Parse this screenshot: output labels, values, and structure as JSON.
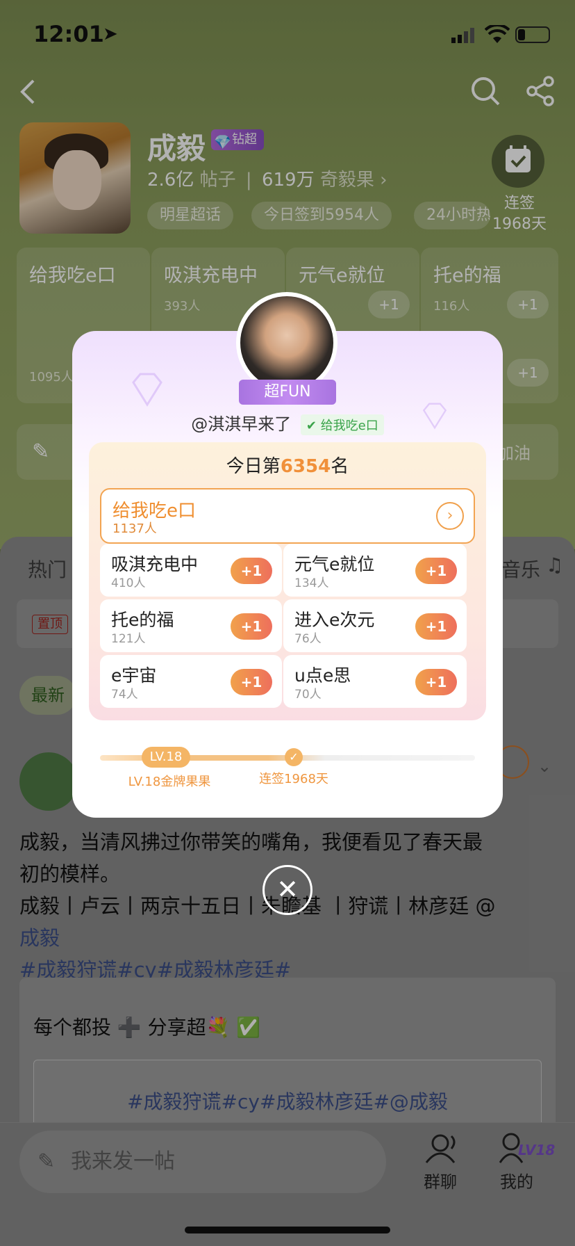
{
  "status": {
    "time": "12:01"
  },
  "star": {
    "name": "成毅",
    "badge": "钻超",
    "posts_num": "2.6亿",
    "posts_label": "帖子",
    "fruit_num": "619万",
    "fruit_label": "奇毅果",
    "chips": [
      "明星超话",
      "今日签到5954人",
      "24小时热"
    ],
    "checkin": {
      "label": "连签",
      "days": "1968天"
    }
  },
  "header_ranks": [
    {
      "title": "给我吃e口",
      "count": "1095人",
      "plus": "+1"
    },
    {
      "title": "吸淇充电中",
      "count": "393人",
      "plus": "+1"
    },
    {
      "title": "元气e就位",
      "count": "",
      "plus": "+1"
    },
    {
      "title": "托e的福",
      "count": "116人",
      "plus": "+1"
    }
  ],
  "gray_bar_right": "加油",
  "feed": {
    "tabs": [
      "热门",
      "音乐"
    ],
    "pinned": "置顶",
    "newest": "最新",
    "post_lines": [
      "成毅，当清风拂过你带笑的嘴角，我便看见了春天最",
      "初的模样。",
      "成毅丨卢云丨两京十五日丨朱瞻基 丨狩谎丨林彦廷 @",
      "成毅",
      "#成毅狩谎#cy#成毅林彦廷#"
    ],
    "share_title": "每个都投 ➕ 分享超💐 ✅",
    "share_link": "#成毅狩谎#cy#成毅林彦廷#@成毅"
  },
  "bottom": {
    "compose": "我来发一帖",
    "group": "群聊",
    "mine": "我的",
    "level": "LV18"
  },
  "dialog": {
    "badge": "超FUN",
    "user": "@淇淇早来了",
    "user_tag": "给我吃e口",
    "rank_prefix": "今日第",
    "rank_num": "6354",
    "rank_suffix": "名",
    "current": {
      "title": "给我吃e口",
      "count": "1137人"
    },
    "items": [
      {
        "title": "吸淇充电中",
        "count": "410人",
        "plus": "+1"
      },
      {
        "title": "元气e就位",
        "count": "134人",
        "plus": "+1"
      },
      {
        "title": "托e的福",
        "count": "121人",
        "plus": "+1"
      },
      {
        "title": "进入e次元",
        "count": "76人",
        "plus": "+1"
      },
      {
        "title": "e宇宙",
        "count": "74人",
        "plus": "+1"
      },
      {
        "title": "u点e思",
        "count": "70人",
        "plus": "+1"
      }
    ],
    "level_pill": "LV.18",
    "level_label": "LV.18金牌果果",
    "checkin_label": "连签1968天"
  },
  "colors": {
    "accent": "#f0903a",
    "purple": "#a874e0",
    "plus_grad": "#ee6f5c"
  }
}
